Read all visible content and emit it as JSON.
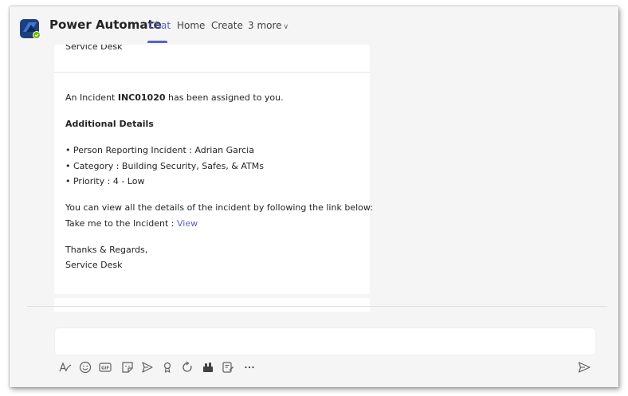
{
  "header": {
    "app_title": "Power Automate",
    "tabs": [
      {
        "label": "Chat"
      },
      {
        "label": "Home"
      },
      {
        "label": "Create"
      },
      {
        "label": "3 more"
      }
    ]
  },
  "message_prev": {
    "signature": "Service Desk"
  },
  "message": {
    "intro_prefix": "An Incident ",
    "incident_id": "INC01020",
    "intro_suffix": " has been assigned to you.",
    "details_heading": "Additional Details",
    "details": [
      "• Person Reporting Incident : Adrian Garcia",
      "• Category : Building Security, Safes, & ATMs",
      "• Priority : 4 - Low"
    ],
    "view_line": "You can view all the details of the incident by following the link below:",
    "link_prefix": "Take me to the Incident : ",
    "link_text": "View",
    "closing": "Thanks & Regards,",
    "signature": "Service Desk"
  },
  "composer": {
    "toolbar": [
      {
        "icon": "format-icon"
      },
      {
        "icon": "emoji-icon"
      },
      {
        "icon": "gif-icon"
      },
      {
        "icon": "sticker-icon"
      },
      {
        "icon": "schedule-send-icon"
      },
      {
        "icon": "praise-icon"
      },
      {
        "icon": "loop-icon"
      },
      {
        "icon": "apps-icon"
      },
      {
        "icon": "updates-icon"
      },
      {
        "icon": "more-icon"
      }
    ],
    "send_icon": "send-icon",
    "colors": {
      "accent": "#5b5fc7"
    }
  }
}
